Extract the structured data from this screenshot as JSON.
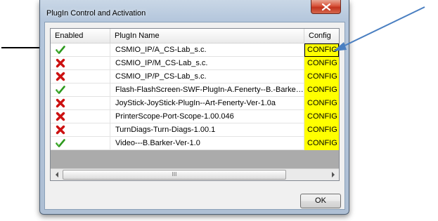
{
  "window": {
    "title": "PlugIn Control and Activation",
    "close_icon": "close-x-icon"
  },
  "columns": {
    "enabled": "Enabled",
    "plugin_name": "PlugIn Name",
    "config": "Config"
  },
  "plugins": [
    {
      "enabled": true,
      "name": "CSMIO_IP/A_CS-Lab_s.c.",
      "config": "CONFIG"
    },
    {
      "enabled": false,
      "name": "CSMIO_IP/M_CS-Lab_s.c.",
      "config": "CONFIG"
    },
    {
      "enabled": false,
      "name": "CSMIO_IP/P_CS-Lab_s.c.",
      "config": "CONFIG"
    },
    {
      "enabled": true,
      "name": "Flash-FlashScreen-SWF-PlugIn-A.Fenerty--B.-Barker-...",
      "config": "CONFIG"
    },
    {
      "enabled": false,
      "name": "JoyStick-JoyStick-PlugIn--Art-Fenerty-Ver-1.0a",
      "config": "CONFIG"
    },
    {
      "enabled": false,
      "name": "PrinterScope-Port-Scope-1.00.046",
      "config": "CONFIG"
    },
    {
      "enabled": false,
      "name": "TurnDiags-Turn-Diags-1.00.1",
      "config": "CONFIG"
    },
    {
      "enabled": true,
      "name": "Video---B.Barker-Ver-1.0",
      "config": "CONFIG"
    }
  ],
  "scrollbar": {
    "left_icon": "scroll-left-icon",
    "right_icon": "scroll-right-icon",
    "thumb_grip": "III"
  },
  "buttons": {
    "ok": "OK"
  },
  "colors": {
    "config_cell": "#ffff00",
    "enabled_check": "#2e9a1e",
    "disabled_x": "#cc1010",
    "annotation_black_arrow": "#000000",
    "annotation_blue_arrow": "#4a7fc1"
  }
}
